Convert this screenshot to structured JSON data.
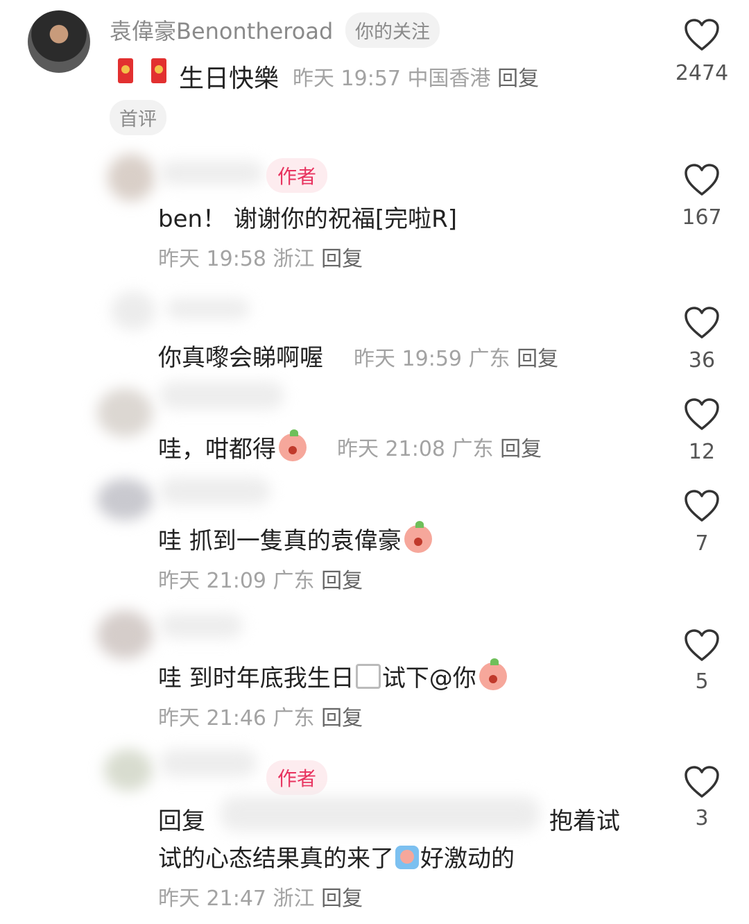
{
  "main_comment": {
    "username": "袁偉豪Benontheroad",
    "follow_badge": "你的关注",
    "text": "生日快樂",
    "meta_time": "昨天 19:57",
    "meta_location": "中国香港",
    "reply_label": "回复",
    "first_badge": "首评",
    "like_count": "2474"
  },
  "replies": [
    {
      "author_badge": "作者",
      "text": "ben！ 谢谢你的祝福[完啦R]",
      "meta_time": "昨天 19:58",
      "meta_location": "浙江",
      "reply_label": "回复",
      "like_count": "167"
    },
    {
      "text": "你真嚟会睇啊喔",
      "meta_time": "昨天 19:59",
      "meta_location": "广东",
      "reply_label": "回复",
      "like_count": "36"
    },
    {
      "text": "哇，咁都得",
      "meta_time": "昨天 21:08",
      "meta_location": "广东",
      "reply_label": "回复",
      "like_count": "12"
    },
    {
      "text": "哇 抓到一隻真的袁偉豪",
      "meta_time": "昨天 21:09",
      "meta_location": "广东",
      "reply_label": "回复",
      "like_count": "7"
    },
    {
      "text_a": "哇 到时年底我生日",
      "text_b": "试下@你",
      "meta_time": "昨天 21:46",
      "meta_location": "广东",
      "reply_label": "回复",
      "like_count": "5"
    },
    {
      "author_badge": "作者",
      "text_prefix": "回复",
      "text_suffix": "抱着试",
      "text_line2": "试的心态结果真的来了",
      "text_line2_end": "好激动的",
      "meta_time": "昨天 21:47",
      "meta_location": "浙江",
      "reply_label": "回复",
      "like_count": "3"
    }
  ],
  "colors": {
    "accent": "#e8335f",
    "meta": "#a3a3a3"
  },
  "icons": {
    "like": "heart-icon",
    "envelope": "red-envelope-icon",
    "sticker": "peach-sticker-icon"
  }
}
